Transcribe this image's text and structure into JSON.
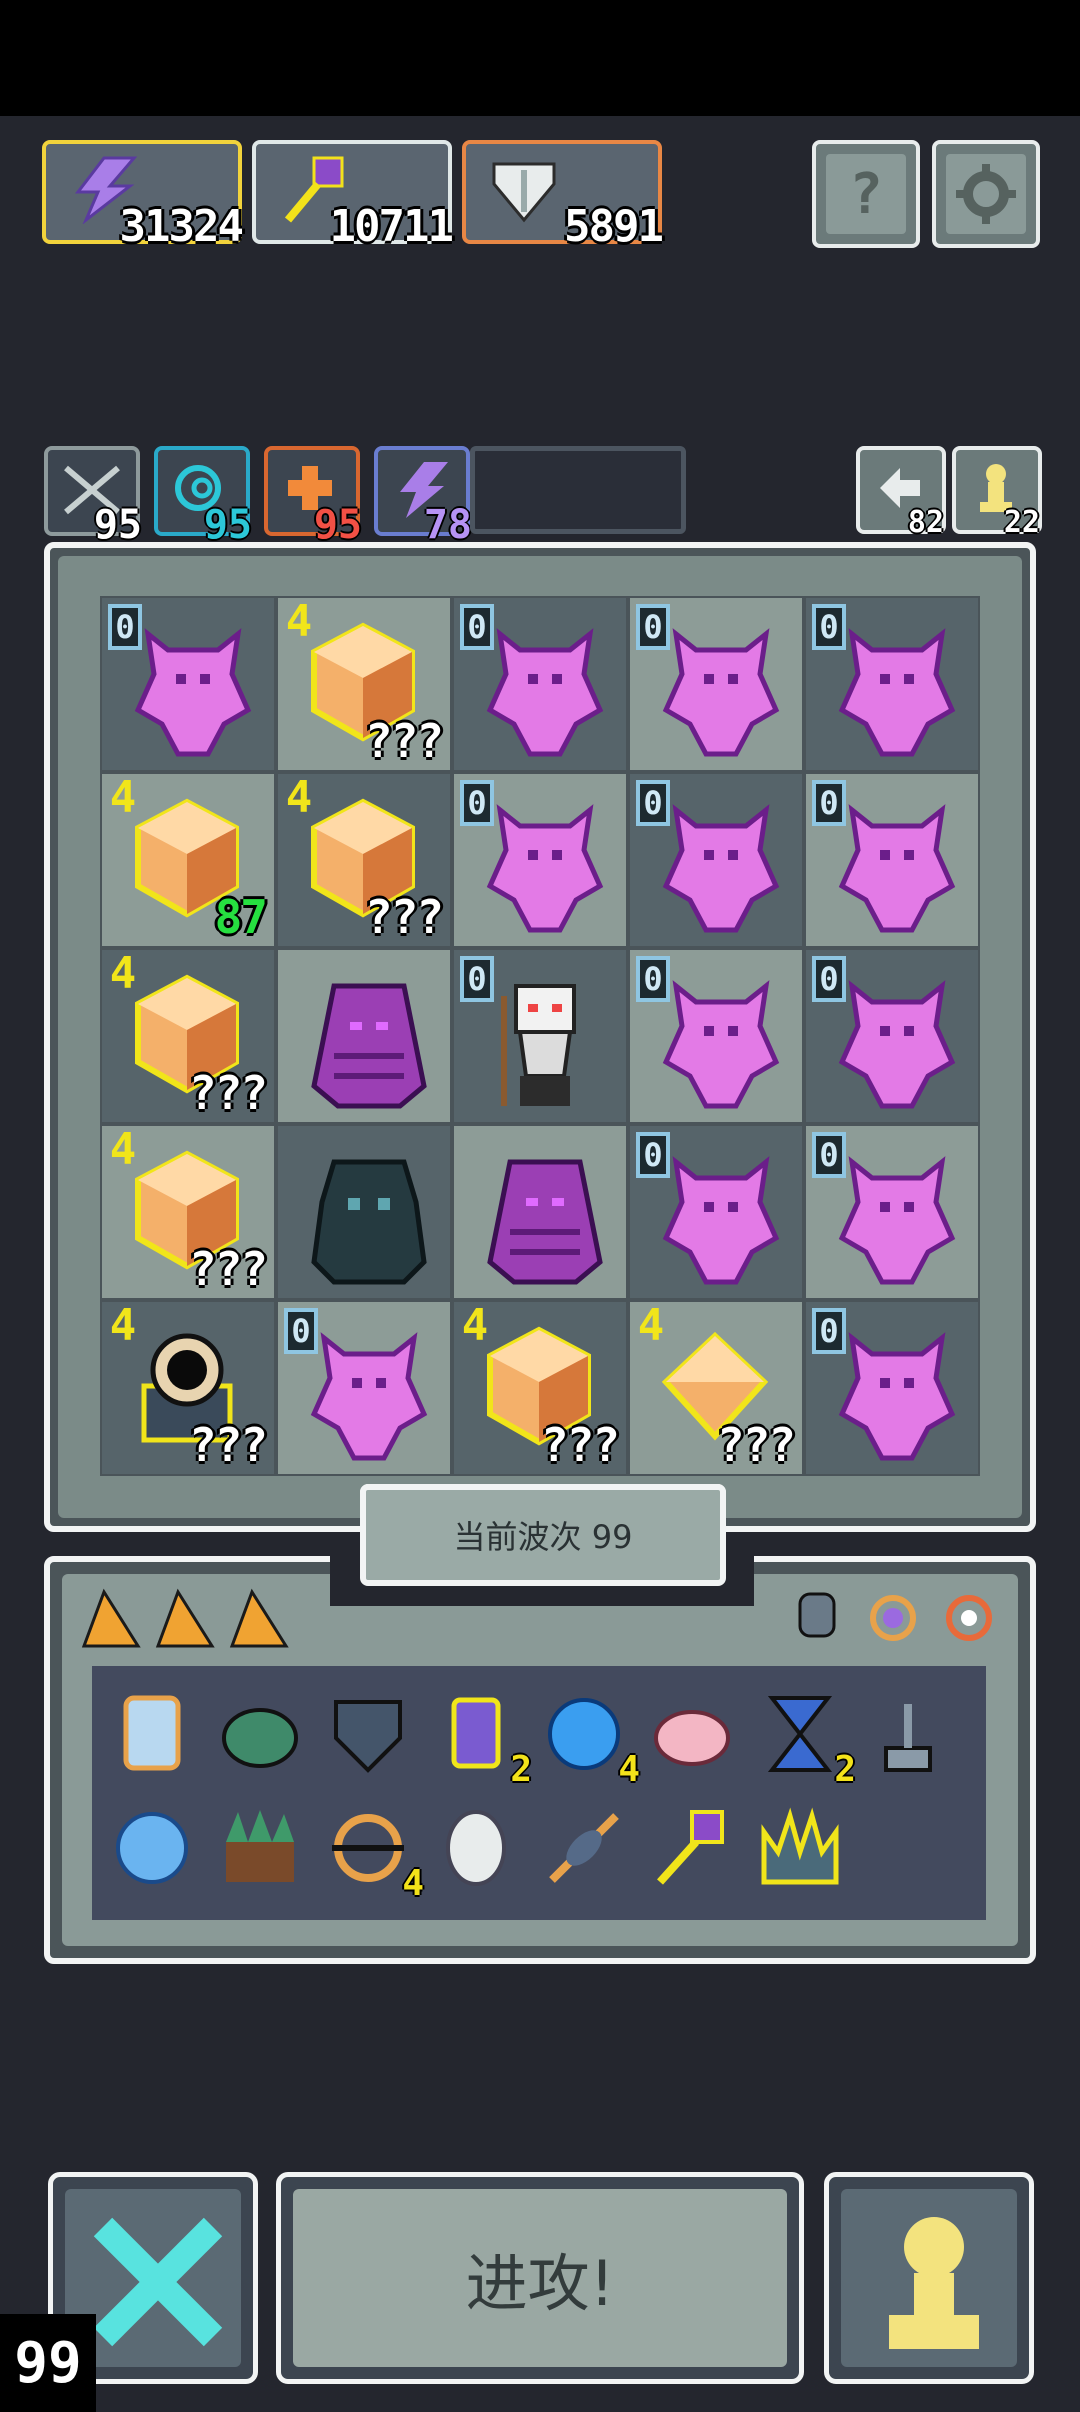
{
  "resources": [
    {
      "name": "lightning-resource",
      "value": "31324",
      "border": "#f2d33c",
      "icon": "purple-lightning-icon"
    },
    {
      "name": "staff-resource",
      "value": "10711",
      "border": "#e0e8e8",
      "icon": "purple-staff-icon"
    },
    {
      "name": "shield-resource",
      "value": "5891",
      "border": "#e88745",
      "icon": "white-shield-icon"
    }
  ],
  "buttons": {
    "help": "?",
    "settings": "gear-icon"
  },
  "stats": [
    {
      "name": "sword-stat",
      "value": "95",
      "border": "#8e9a9c",
      "color": "#ffffff"
    },
    {
      "name": "vortex-stat",
      "value": "95",
      "border": "#2aa9c9",
      "color": "#2cc7d8"
    },
    {
      "name": "heal-stat",
      "value": "95",
      "border": "#d96730",
      "color": "#f25045"
    },
    {
      "name": "lightning-stat",
      "value": "78",
      "border": "#6a7dd0",
      "color": "#b693f5"
    }
  ],
  "counters": [
    {
      "name": "swap-counter",
      "value": "82",
      "icon": "swap-icon"
    },
    {
      "name": "pawn-counter",
      "value": "22",
      "icon": "pawn-icon"
    }
  ],
  "board": [
    [
      {
        "t": "demon",
        "lvl": "0"
      },
      {
        "t": "crystal",
        "lvl": "4",
        "cnt": "???"
      },
      {
        "t": "demon",
        "lvl": "0"
      },
      {
        "t": "demon",
        "lvl": "0"
      },
      {
        "t": "demon",
        "lvl": "0"
      }
    ],
    [
      {
        "t": "crystal",
        "lvl": "4",
        "cnt": "87",
        "green": true
      },
      {
        "t": "crystal",
        "lvl": "4",
        "cnt": "???"
      },
      {
        "t": "demon",
        "lvl": "0"
      },
      {
        "t": "demon",
        "lvl": "0"
      },
      {
        "t": "demon",
        "lvl": "0"
      }
    ],
    [
      {
        "t": "crystal",
        "lvl": "4",
        "cnt": "???"
      },
      {
        "t": "hooded"
      },
      {
        "t": "wizard",
        "lvl": "0"
      },
      {
        "t": "demon",
        "lvl": "0"
      },
      {
        "t": "demon",
        "lvl": "0"
      }
    ],
    [
      {
        "t": "crystal",
        "lvl": "4",
        "cnt": "???"
      },
      {
        "t": "shadow"
      },
      {
        "t": "hooded"
      },
      {
        "t": "demon",
        "lvl": "0"
      },
      {
        "t": "demon",
        "lvl": "0"
      }
    ],
    [
      {
        "t": "portal",
        "lvl": "4",
        "cnt": "???"
      },
      {
        "t": "demon",
        "lvl": "0"
      },
      {
        "t": "crystal",
        "lvl": "4",
        "cnt": "???"
      },
      {
        "t": "gem",
        "lvl": "4",
        "cnt": "???"
      },
      {
        "t": "demon",
        "lvl": "0"
      }
    ]
  ],
  "wave_label": "当前波次 99",
  "inventory_row1": [
    {
      "icon": "mirror-icon"
    },
    {
      "icon": "turtle-shell-icon"
    },
    {
      "icon": "shield-icon"
    },
    {
      "icon": "potion-jar-icon",
      "count": "2"
    },
    {
      "icon": "blue-orb-icon",
      "count": "4"
    },
    {
      "icon": "piggy-bank-icon"
    },
    {
      "icon": "hourglass-icon",
      "count": "2"
    },
    {
      "icon": "lever-icon"
    }
  ],
  "inventory_row2": [
    {
      "icon": "blue-bubble-icon"
    },
    {
      "icon": "grass-block-icon"
    },
    {
      "icon": "gyro-icon",
      "count": "4"
    },
    {
      "icon": "white-egg-icon"
    },
    {
      "icon": "feather-dart-icon"
    },
    {
      "icon": "purple-staff-icon"
    },
    {
      "icon": "spiky-crown-icon"
    }
  ],
  "action_buttons": {
    "cancel": "close-icon",
    "attack": "进攻!",
    "pawn": "pawn-icon"
  },
  "corner_level": "99"
}
